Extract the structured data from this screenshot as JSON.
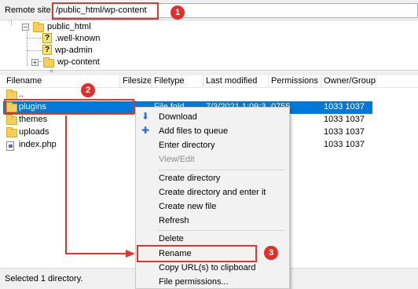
{
  "remote_site": {
    "label": "Remote site:",
    "path": "/public_html/wp-content"
  },
  "tree": {
    "items": [
      {
        "label": "public_html",
        "icon": "folder-icon"
      },
      {
        "label": ".well-known",
        "icon": "unknown-folder-icon"
      },
      {
        "label": "wp-admin",
        "icon": "unknown-folder-icon"
      },
      {
        "label": "wp-content",
        "icon": "folder-icon"
      }
    ],
    "expander_minus": "−",
    "expander_plus": "+"
  },
  "columns": {
    "filename": "Filename",
    "filesize": "Filesize",
    "filetype": "Filetype",
    "last_modified": "Last modified",
    "permissions": "Permissions",
    "owner_group": "Owner/Group"
  },
  "files": [
    {
      "name": "..",
      "type": "",
      "modified": "",
      "perms": "",
      "owner": "",
      "icon": "folder-icon"
    },
    {
      "name": "plugins",
      "type": "File fold",
      "modified": "7/3/2021 1:09:3",
      "perms": "0755",
      "owner": "1033 1037",
      "icon": "folder-icon",
      "selected": true
    },
    {
      "name": "themes",
      "type": "",
      "modified": "",
      "perms": "",
      "owner": "1033 1037",
      "icon": "folder-icon"
    },
    {
      "name": "uploads",
      "type": "",
      "modified": "",
      "perms": "",
      "owner": "1033 1037",
      "icon": "folder-icon"
    },
    {
      "name": "index.php",
      "type": "",
      "modified": "",
      "perms": "",
      "owner": "1033 1037",
      "icon": "php-file-icon"
    }
  ],
  "context_menu": {
    "download": "Download",
    "add_to_queue": "Add files to queue",
    "enter_directory": "Enter directory",
    "view_edit": "View/Edit",
    "create_directory": "Create directory",
    "create_directory_enter": "Create directory and enter it",
    "create_new_file": "Create new file",
    "refresh": "Refresh",
    "delete": "Delete",
    "rename": "Rename",
    "copy_urls": "Copy URL(s) to clipboard",
    "file_permissions": "File permissions..."
  },
  "status": {
    "text": "Selected 1 directory."
  },
  "annotations": {
    "step1": "1",
    "step2": "2",
    "step3": "3",
    "color": "#d53a35"
  },
  "colors": {
    "selection": "#0078d7",
    "folder": "#f5cf5c"
  }
}
